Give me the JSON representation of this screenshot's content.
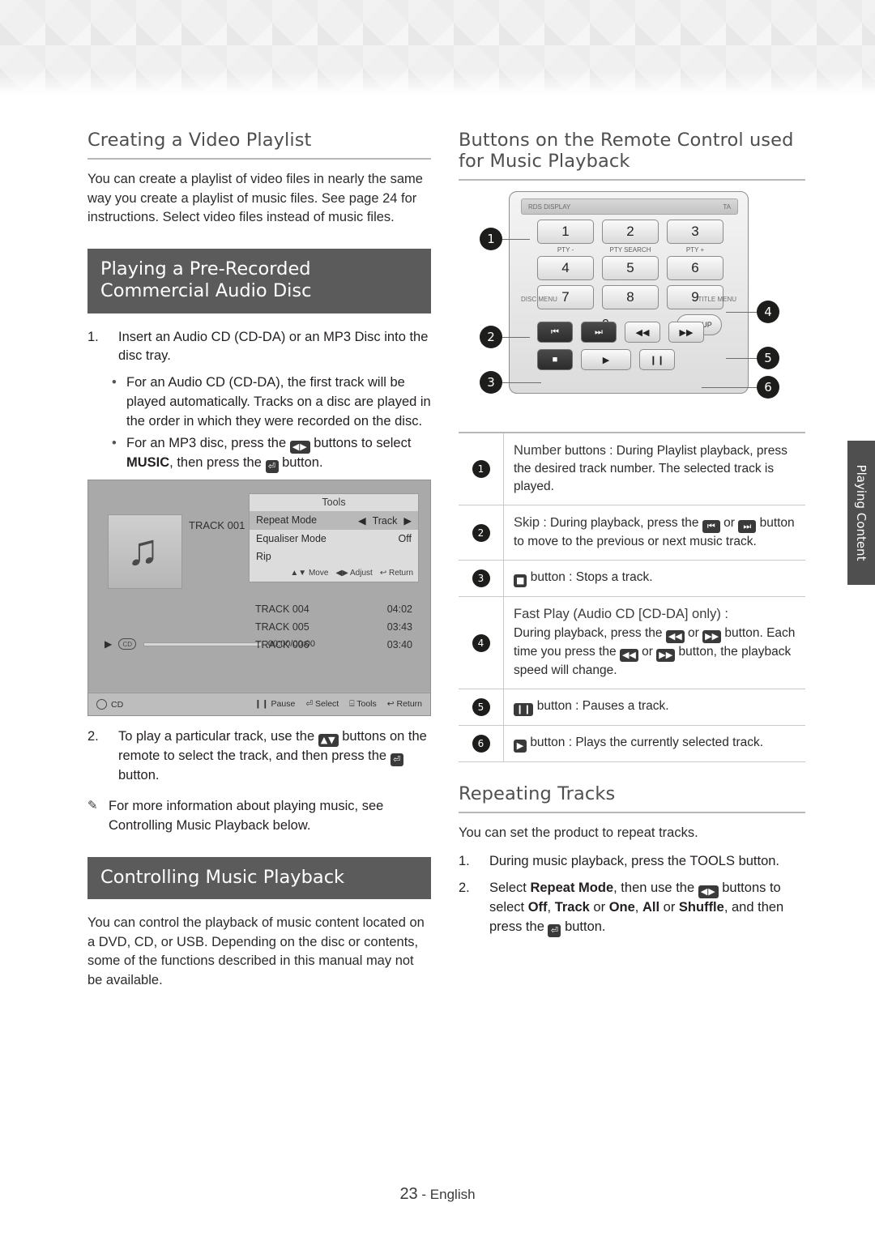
{
  "page": {
    "number": "23",
    "footer_lang": "- English",
    "side_tab": "Playing Content"
  },
  "left": {
    "heading1": "Creating a Video Playlist",
    "para1": "You can create a playlist of video files in nearly the same way you create a playlist of music files. See page 24 for instructions. Select video files instead of music files.",
    "heading2": "Playing a Pre-Recorded Commercial Audio Disc",
    "step1_num": "1.",
    "step1_text": "Insert an Audio CD (CD-DA) or an MP3 Disc into the disc tray.",
    "bullet1": "For an Audio CD (CD-DA), the first track will be played automatically. Tracks on a disc are played in the order in which they were recorded on the disc.",
    "bullet2_pre": "For an MP3 disc, press the",
    "bullet2_mid": "buttons to select",
    "bullet2_music": "MUSIC",
    "bullet2_then": ", then press the",
    "bullet2_end": "button.",
    "step2_num": "2.",
    "step2_pre": "To play a particular track, use the",
    "step2_mid": "buttons on the remote to select the track, and then press the",
    "step2_end": "button.",
    "note_text": "For more information about playing music, see Controlling Music Playback below.",
    "heading3": "Controlling Music Playback",
    "para3": "You can control the playback of music content located on a DVD, CD, or USB. Depending on the disc or contents, some of the functions described in this manual may not be available."
  },
  "screenshot": {
    "track_label": "TRACK 001",
    "time": "00:00/00:00",
    "tools_title": "Tools",
    "tools_rows": [
      {
        "label": "Repeat Mode",
        "value": "Track",
        "selected": true
      },
      {
        "label": "Equaliser Mode",
        "value": "Off",
        "selected": false
      },
      {
        "label": "Rip",
        "value": "",
        "selected": false
      }
    ],
    "tools_legend": [
      "Move",
      "Adjust",
      "Return"
    ],
    "tracks": [
      {
        "name": "TRACK 004",
        "time": "04:02"
      },
      {
        "name": "TRACK 005",
        "time": "03:43"
      },
      {
        "name": "TRACK 006",
        "time": "03:40"
      }
    ],
    "footer_left": "CD",
    "footer_right": [
      "Pause",
      "Select",
      "Tools",
      "Return"
    ]
  },
  "right": {
    "heading1": "Buttons on the Remote Control used for Music Playback",
    "remote": {
      "top_left_label": "RDS DISPLAY",
      "top_right_label": "TA",
      "keys": [
        "1",
        "2",
        "3",
        "4",
        "5",
        "6",
        "7",
        "8",
        "9",
        "0"
      ],
      "sub_labels": [
        "PTY -",
        "PTY SEARCH",
        "PTY +"
      ],
      "popup_label": "POPUP",
      "disc_menu_label": "DISC MENU",
      "title_menu_label": "TITLE MENU",
      "callouts": [
        "1",
        "2",
        "3",
        "4",
        "5",
        "6"
      ]
    },
    "legend": [
      {
        "n": "1",
        "lead": "Number",
        "text": " buttons : During Playlist playback, press the desired track number. The selected track is played."
      },
      {
        "n": "2",
        "lead": "Skip",
        "text": " : During playback, press the  or  button to move to the previous or next music track."
      },
      {
        "n": "3",
        "lead": "",
        "text": " button : Stops a track."
      },
      {
        "n": "4",
        "lead": "Fast Play (Audio CD [CD-DA] only) :",
        "text": "During playback, press the  or  button. Each time you press the  or  button, the playback speed will change."
      },
      {
        "n": "5",
        "lead": "",
        "text": " button : Pauses a track."
      },
      {
        "n": "6",
        "lead": "",
        "text": " button : Plays the currently selected track."
      }
    ],
    "heading2": "Repeating Tracks",
    "para2": "You can set the product to repeat tracks.",
    "step1_num": "1.",
    "step1_pre": "During music playback, press the",
    "step1_tools": "TOOLS",
    "step1_end": "button.",
    "step2_num": "2.",
    "step2_pre": "Select",
    "step2_repeat": "Repeat Mode",
    "step2_mid": ", then use the",
    "step2_mid2": "buttons to select",
    "step2_off": "Off",
    "step2_track": "Track",
    "step2_or1": "or",
    "step2_one": "One",
    "step2_all": "All",
    "step2_or2": "or",
    "step2_shuffle": "Shuffle",
    "step2_and": ", and then press the",
    "step2_end": "button."
  }
}
